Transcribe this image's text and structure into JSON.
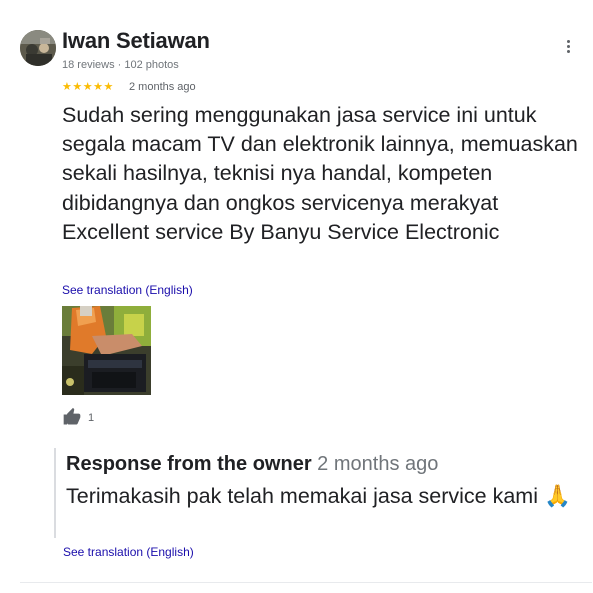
{
  "reviewer": {
    "name": "Iwan Setiawan",
    "meta": "18 reviews · 102 photos"
  },
  "review": {
    "stars": "★★★★★",
    "rating": 5,
    "date": "2 months ago",
    "text": "Sudah sering menggunakan jasa service ini untuk segala macam TV dan elektronik lainnya, memuaskan sekali hasilnya, teknisi nya handal, kompeten dibidangnya dan ongkos servicenya merakyat\nExcellent service By Banyu Service Electronic",
    "translate_label": "See translation (English)",
    "like_count": "1"
  },
  "owner_response": {
    "label": "Response from the owner",
    "date": "2 months ago",
    "text": "Terimakasih pak telah memakai jasa service kami 🙏",
    "translate_label": "See translation (English)"
  },
  "colors": {
    "star": "#fbbc04",
    "link": "#1a0dab",
    "muted": "#70757a"
  },
  "icons": [
    "avatar-photo",
    "more-vert-icon",
    "star-icon",
    "thumbs-up-icon"
  ]
}
